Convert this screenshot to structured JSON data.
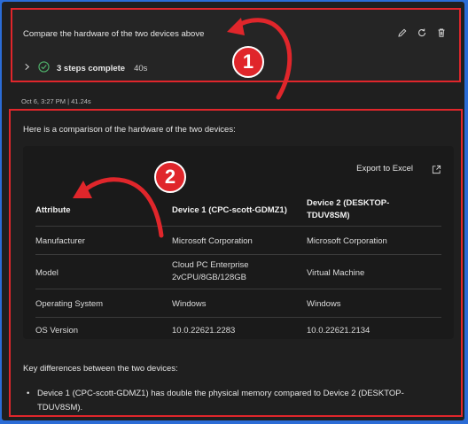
{
  "prompt": {
    "text": "Compare the hardware of the two devices above",
    "actions": [
      {
        "icon": "edit-icon"
      },
      {
        "icon": "refresh-icon"
      },
      {
        "icon": "trash-icon"
      }
    ]
  },
  "steps": {
    "label": "3 steps complete",
    "duration": "40s"
  },
  "meta": {
    "timestamp": "Oct 6, 3:27 PM | 41.24s"
  },
  "response": {
    "intro": "Here is a comparison of the hardware of the two devices:",
    "export_label": "Export to Excel",
    "table": {
      "headers": [
        "Attribute",
        "Device 1 (CPC-scott-GDMZ1)",
        "Device 2 (DESKTOP-TDUV8SM)"
      ],
      "rows": [
        [
          "Manufacturer",
          "Microsoft Corporation",
          "Microsoft Corporation"
        ],
        [
          "Model",
          "Cloud PC Enterprise 2vCPU/8GB/128GB",
          "Virtual Machine"
        ],
        [
          "Operating System",
          "Windows",
          "Windows"
        ],
        [
          "OS Version",
          "10.0.22621.2283",
          "10.0.22621.2134"
        ]
      ]
    },
    "key_differences_title": "Key differences between the two devices:",
    "bullets": [
      "Device 1 (CPC-scott-GDMZ1) has double the physical memory compared to Device 2 (DESKTOP-TDUV8SM)."
    ]
  },
  "annotations": {
    "badge1": "1",
    "badge2": "2",
    "color": "#e0262b"
  }
}
